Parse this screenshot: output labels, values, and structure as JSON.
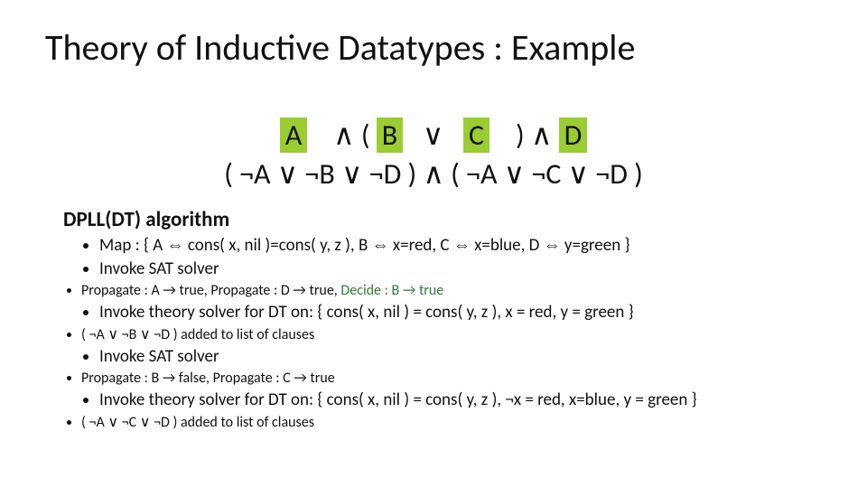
{
  "title": "Theory of Inductive Datatypes : Example",
  "formula": {
    "A": "A",
    "and_open": "∧ ( ",
    "B": "B",
    "or": "   ∨   ",
    "C": "C",
    "close_and": "    ) ∧ ",
    "D": "D",
    "line2": "( ¬A ∨ ¬B ∨ ¬D ) ∧ ( ¬A ∨ ¬C ∨ ¬D )"
  },
  "subhead": "DPLL(DT) algorithm",
  "b1": "Map :  { A ⇔ cons( x, nil )=cons( y, z ), B ⇔ x=red, C ⇔ x=blue, D ⇔ y=green }",
  "b2": "Invoke SAT solver",
  "b2a_pre": "Propagate : A → true, Propagate : D → true,  ",
  "b2a_green": "Decide : B → true",
  "b3": "Invoke theory solver for DT on: { cons( x, nil ) = cons( y, z ), x = red, y = green }",
  "b3a": "( ¬A ∨ ¬B ∨ ¬D ) added to list of clauses",
  "b4": "Invoke SAT solver",
  "b4a": "Propagate : B → false, Propagate : C → true",
  "b5": "Invoke theory solver for DT on: { cons( x, nil ) = cons( y, z ), ¬x = red, x=blue, y = green }",
  "b5a": "( ¬A ∨ ¬C ∨ ¬D ) added to list of clauses"
}
